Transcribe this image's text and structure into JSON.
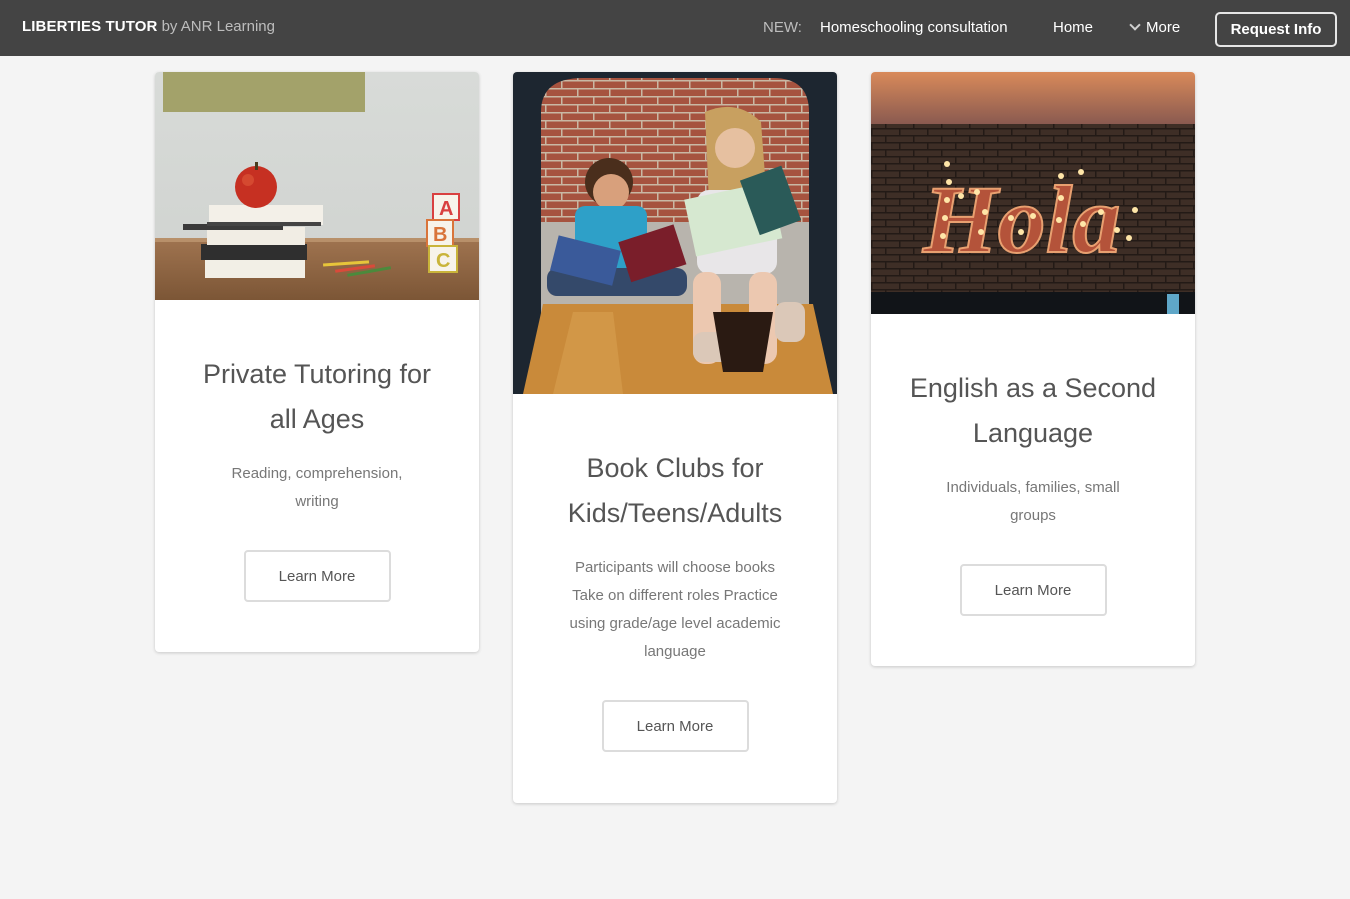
{
  "nav": {
    "brand_name": "LIBERTIES TUTOR",
    "brand_by": "by ANR Learning",
    "new_label": "NEW:",
    "consultation_link": "Homeschooling consultation",
    "home_link": "Home",
    "more_link": "More",
    "request_button": "Request Info"
  },
  "cards": [
    {
      "title": "Private Tutoring for all Ages",
      "description": "Reading, comprehension, writing",
      "button": "Learn More",
      "image": "books-apple-abc-blocks-photo"
    },
    {
      "title": "Book Clubs for Kids/Teens/Adults",
      "description": "Participants will choose books Take on different roles Practice using grade/age level academic language",
      "button": "Learn More",
      "image": "children-reading-photo"
    },
    {
      "title": "English as a Second Language",
      "description": "Individuals, families, small groups",
      "button": "Learn More",
      "image": "hola-marquee-sign-photo"
    }
  ],
  "colors": {
    "nav_background": "#444444",
    "page_background": "#f4f4f4",
    "card_background": "#ffffff"
  }
}
